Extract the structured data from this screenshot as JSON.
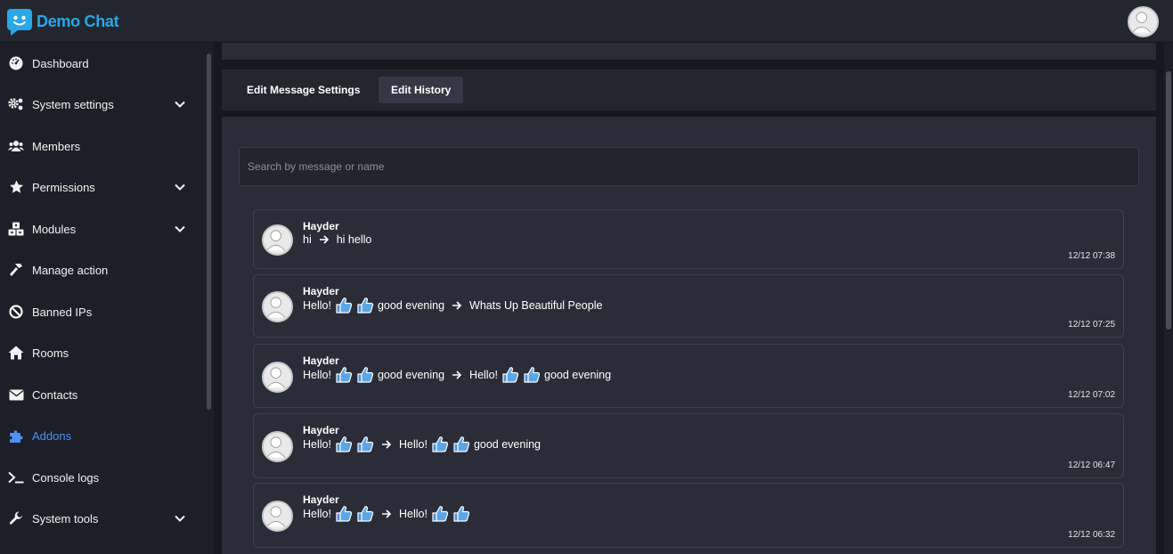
{
  "app": {
    "name": "Demo Chat"
  },
  "colors": {
    "accent": "#4f8ff7",
    "brand": "#29a8e6",
    "bg": "#1b1e27",
    "panel": "#2a2d38"
  },
  "sidebar": {
    "items": [
      {
        "label": "Dashboard",
        "icon": "dashboard-icon",
        "has_submenu": false
      },
      {
        "label": "System settings",
        "icon": "cogs-icon",
        "has_submenu": true
      },
      {
        "label": "Members",
        "icon": "users-icon",
        "has_submenu": false
      },
      {
        "label": "Permissions",
        "icon": "star-icon",
        "has_submenu": true
      },
      {
        "label": "Modules",
        "icon": "cubes-icon",
        "has_submenu": true
      },
      {
        "label": "Manage action",
        "icon": "hammer-icon",
        "has_submenu": false
      },
      {
        "label": "Banned IPs",
        "icon": "ban-icon",
        "has_submenu": false
      },
      {
        "label": "Rooms",
        "icon": "home-icon",
        "has_submenu": false
      },
      {
        "label": "Contacts",
        "icon": "envelope-icon",
        "has_submenu": false
      },
      {
        "label": "Addons",
        "icon": "puzzle-icon",
        "has_submenu": false,
        "active": true
      },
      {
        "label": "Console logs",
        "icon": "terminal-icon",
        "has_submenu": false
      },
      {
        "label": "System tools",
        "icon": "wrench-icon",
        "has_submenu": true
      }
    ]
  },
  "tabs": [
    {
      "label": "Edit Message Settings",
      "active": false
    },
    {
      "label": "Edit History",
      "active": true
    }
  ],
  "search": {
    "placeholder": "Search by message or name",
    "value": ""
  },
  "history": [
    {
      "name": "Hayder",
      "time": "12/12 07:38",
      "before": [
        {
          "t": "text",
          "v": "hi"
        }
      ],
      "after": [
        {
          "t": "text",
          "v": "hi hello"
        }
      ]
    },
    {
      "name": "Hayder",
      "time": "12/12 07:25",
      "before": [
        {
          "t": "text",
          "v": "Hello!"
        },
        {
          "t": "emoji",
          "v": "thumbs-up"
        },
        {
          "t": "emoji",
          "v": "thumbs-up"
        },
        {
          "t": "text",
          "v": "good evening"
        }
      ],
      "after": [
        {
          "t": "text",
          "v": "Whats Up Beautiful People"
        }
      ]
    },
    {
      "name": "Hayder",
      "time": "12/12 07:02",
      "before": [
        {
          "t": "text",
          "v": "Hello!"
        },
        {
          "t": "emoji",
          "v": "thumbs-up"
        },
        {
          "t": "emoji",
          "v": "thumbs-up"
        },
        {
          "t": "text",
          "v": "good evening"
        }
      ],
      "after": [
        {
          "t": "text",
          "v": "Hello!"
        },
        {
          "t": "emoji",
          "v": "thumbs-up"
        },
        {
          "t": "emoji",
          "v": "thumbs-up"
        },
        {
          "t": "text",
          "v": "good evening"
        }
      ]
    },
    {
      "name": "Hayder",
      "time": "12/12 06:47",
      "before": [
        {
          "t": "text",
          "v": "Hello!"
        },
        {
          "t": "emoji",
          "v": "thumbs-up"
        },
        {
          "t": "emoji",
          "v": "thumbs-up"
        }
      ],
      "after": [
        {
          "t": "text",
          "v": "Hello!"
        },
        {
          "t": "emoji",
          "v": "thumbs-up"
        },
        {
          "t": "emoji",
          "v": "thumbs-up"
        },
        {
          "t": "text",
          "v": "good evening"
        }
      ]
    },
    {
      "name": "Hayder",
      "time": "12/12 06:32",
      "before": [
        {
          "t": "text",
          "v": "Hello!"
        },
        {
          "t": "emoji",
          "v": "thumbs-up"
        },
        {
          "t": "emoji",
          "v": "thumbs-up"
        }
      ],
      "after": [
        {
          "t": "text",
          "v": "Hello!"
        },
        {
          "t": "emoji",
          "v": "thumbs-up"
        },
        {
          "t": "emoji",
          "v": "thumbs-up"
        }
      ]
    }
  ]
}
